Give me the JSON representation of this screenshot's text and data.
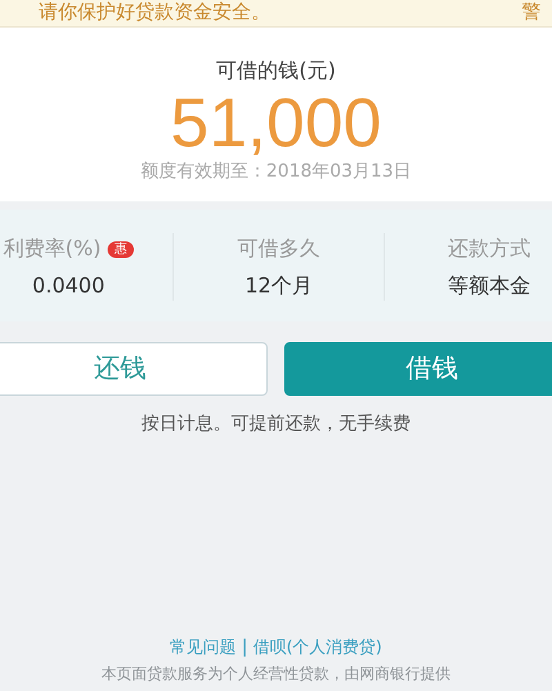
{
  "banner": {
    "text": "请你保护好贷款资金安全。",
    "right_text": "警"
  },
  "amount": {
    "label": "可借的钱(元)",
    "value": "51,000",
    "validity": "额度有效期至：2018年03月13日"
  },
  "stats": [
    {
      "label": "利费率(%)",
      "badge": "惠",
      "value": "0.0400"
    },
    {
      "label": "可借多久",
      "value": "12个月"
    },
    {
      "label": "还款方式",
      "value": "等额本金"
    }
  ],
  "buttons": [
    {
      "label": "还钱",
      "kind": "outline"
    },
    {
      "label": "借钱",
      "kind": "primary"
    }
  ],
  "note": "按日计息。可提前还款，无手续费",
  "footer": {
    "links": [
      "常见问题",
      "借呗(个人消费贷)"
    ],
    "separator": "|",
    "disclaimer": "本页面贷款服务为个人经营性贷款，由网商银行提供"
  }
}
